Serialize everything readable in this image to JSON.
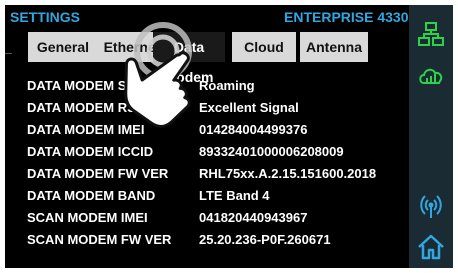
{
  "header": {
    "title": "SETTINGS",
    "device_name": "ENTERPRISE 4330"
  },
  "tabs": [
    {
      "label": "General",
      "active": false
    },
    {
      "label": "Ethernet",
      "active": false
    },
    {
      "label": "Data Modem",
      "active": true
    },
    {
      "label": "Cloud",
      "active": false
    },
    {
      "label": "Antenna",
      "active": false
    }
  ],
  "rows": [
    {
      "label": "DATA MODEM STATUS",
      "value": "Roaming"
    },
    {
      "label": "DATA MODEM RSSI",
      "value": "Excellent Signal"
    },
    {
      "label": "DATA MODEM IMEI",
      "value": "014284004499376"
    },
    {
      "label": "DATA MODEM ICCID",
      "value": "89332401000006208009"
    },
    {
      "label": "DATA MODEM FW VER",
      "value": "RHL75xx.A.2.15.151600.2018"
    },
    {
      "label": "DATA MODEM BAND",
      "value": "LTE Band 4"
    },
    {
      "label": "SCAN MODEM IMEI",
      "value": "041820440943967"
    },
    {
      "label": "SCAN MODEM FW VER",
      "value": "25.20.236-P0F.260671"
    }
  ],
  "sidebar": {
    "icons": [
      "network-icon",
      "cloud-signal-icon",
      "antenna-icon",
      "home-icon"
    ]
  },
  "colors": {
    "accent": "#2fa7e2",
    "green_icon": "#2bd34a",
    "blue_icon": "#2fa7e2"
  }
}
